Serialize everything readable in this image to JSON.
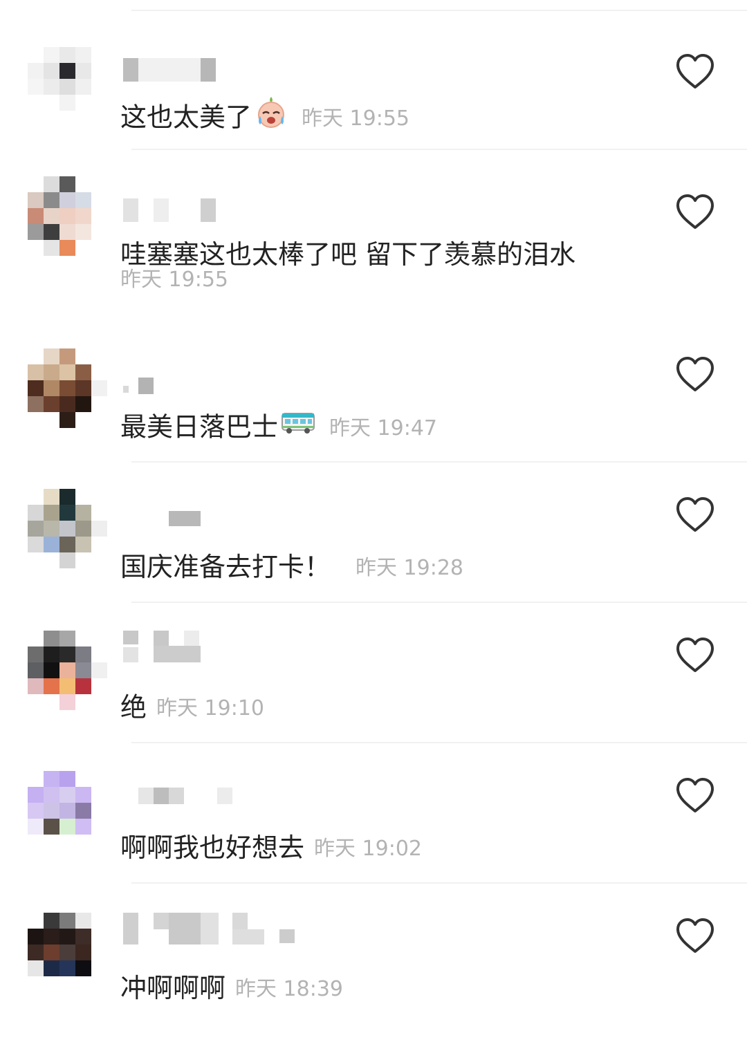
{
  "comments": [
    {
      "text": "这也太美了",
      "emoji": "crying-face-emoji",
      "time": "昨天 19:55"
    },
    {
      "text": "哇塞塞这也太棒了吧 留下了羡慕的泪水",
      "time": "昨天 19:55"
    },
    {
      "text": "最美日落巴士",
      "emoji": "bus-emoji",
      "time": "昨天 19:47"
    },
    {
      "text": "国庆准备去打卡！",
      "time": "昨天 19:28"
    },
    {
      "text": "绝",
      "time": "昨天 19:10"
    },
    {
      "text": "啊啊我也好想去",
      "time": "昨天 19:02"
    },
    {
      "text": "冲啊啊啊",
      "time": "昨天 18:39"
    }
  ],
  "colors": {
    "background": "#ffffff",
    "text": "#222222",
    "time": "#b3b3b3",
    "heart": "#333333",
    "divider": "#f1f1f1"
  },
  "icons": {
    "like": "heart-outline-icon"
  }
}
